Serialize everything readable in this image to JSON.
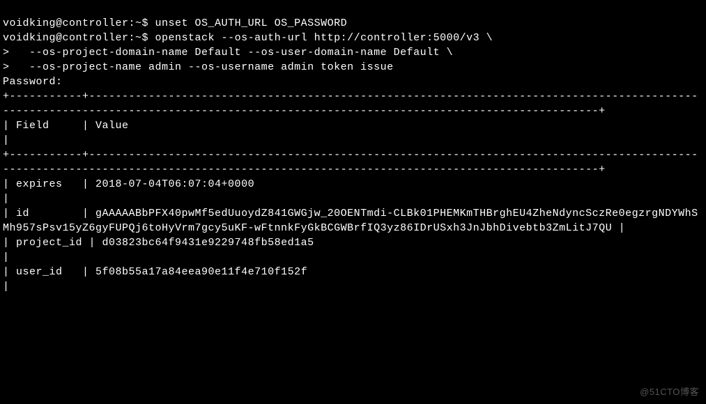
{
  "prompt1": "voidking@controller:~$ ",
  "cmd1": "unset OS_AUTH_URL OS_PASSWORD",
  "prompt2": "voidking@controller:~$ ",
  "cmd2": "openstack --os-auth-url http://controller:5000/v3 \\",
  "cont_prompt": ">   ",
  "cmd2_line2": "--os-project-domain-name Default --os-user-domain-name Default \\",
  "cmd2_line3": "--os-project-name admin --os-username admin token issue",
  "password_label": "Password:",
  "table": {
    "border_top": "+-----------+--------------------------------------------------------------------------------------------------------------------------------------------------------------------------------------+",
    "header": "| Field     | Value                                                                                                                                                                                     |",
    "border_mid": "+-----------+--------------------------------------------------------------------------------------------------------------------------------------------------------------------------------------+",
    "rows": {
      "expires": {
        "label": "| expires   | ",
        "value": "2018-07-04T06:07:04+0000                                                                                                                                                                 |"
      },
      "id": {
        "label": "| id        | ",
        "value": "gAAAAABbPFX40pwMf5edUuoydZ841GWGjw_20OENTmdi-CLBk01PHEMKmTHBrghEU4ZheNdyncSczRe0egzrgNDYWhSMh957sPsv15yZ6gyFUPQj6toHyVrm7gcy5uKF-wFtnnkFyGkBCGWBrfIQ3yz86IDrUSxh3JnJbhDivebtb3ZmLitJ7QU |"
      },
      "project_id": {
        "label": "| project_id | ",
        "value": "d03823bc64f9431e9229748fb58ed1a5                                                                                                                                                         |"
      },
      "user_id": {
        "label": "| user_id   | ",
        "value": "5f08b55a17a84eea90e11f4e710f152f                                                                                                                                                         |"
      }
    }
  },
  "watermark": "@51CTO博客"
}
